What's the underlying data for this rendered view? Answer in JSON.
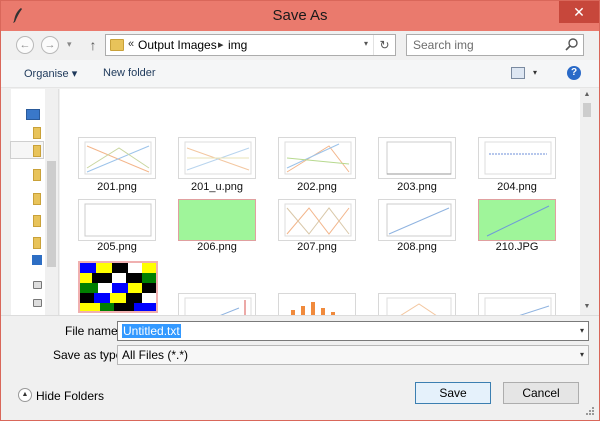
{
  "window": {
    "title": "Save As",
    "close_label": "✕"
  },
  "address": {
    "overflow": "«",
    "crumbs": [
      "Output Images",
      "img"
    ]
  },
  "search": {
    "placeholder": "Search img"
  },
  "toolbar": {
    "organise_label": "Organise ▾",
    "new_folder_label": "New folder",
    "help_label": "?"
  },
  "files": [
    {
      "name": "201.png",
      "thumb": "lines"
    },
    {
      "name": "201_u.png",
      "thumb": "lines"
    },
    {
      "name": "202.png",
      "thumb": "lines"
    },
    {
      "name": "203.png",
      "thumb": "blank-chart"
    },
    {
      "name": "204.png",
      "thumb": "text-chart"
    },
    {
      "name": "205.png",
      "thumb": "blank-chart"
    },
    {
      "name": "206.png",
      "thumb": "green"
    },
    {
      "name": "207.png",
      "thumb": "lines"
    },
    {
      "name": "208.png",
      "thumb": "linear"
    },
    {
      "name": "210.JPG",
      "thumb": "green-line"
    }
  ],
  "form": {
    "file_name_label": "File name:",
    "file_name_value": "Untitled.txt",
    "type_label": "Save as type:",
    "type_value": "All Files (*.*)"
  },
  "footer": {
    "hide_folders_label": "Hide Folders",
    "save_label": "Save",
    "cancel_label": "Cancel"
  },
  "colors": {
    "titlebar": "#ea7a6d",
    "close_button": "#c7473b",
    "selection": "#3399ff",
    "thumb_green": "#9ff59a"
  },
  "icons": [
    "quill-pen-icon",
    "back-arrow-icon",
    "forward-arrow-icon",
    "up-arrow-icon",
    "folder-icon",
    "refresh-icon",
    "search-icon",
    "view-icon",
    "help-icon",
    "chevron-down-icon"
  ]
}
